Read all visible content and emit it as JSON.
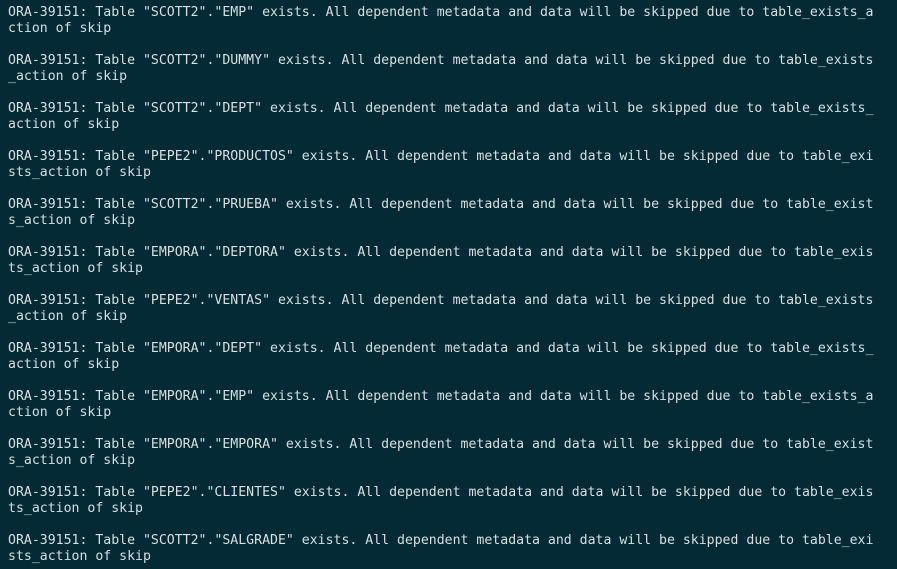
{
  "terminal": {
    "entries": [
      {
        "line1": "ORA-39151: Table \"SCOTT2\".\"EMP\" exists. All dependent metadata and data will be skipped due to table_exists_a",
        "line2": "ction of skip"
      },
      {
        "line1": "ORA-39151: Table \"SCOTT2\".\"DUMMY\" exists. All dependent metadata and data will be skipped due to table_exists",
        "line2": "_action of skip"
      },
      {
        "line1": "ORA-39151: Table \"SCOTT2\".\"DEPT\" exists. All dependent metadata and data will be skipped due to table_exists_",
        "line2": "action of skip"
      },
      {
        "line1": "ORA-39151: Table \"PEPE2\".\"PRODUCTOS\" exists. All dependent metadata and data will be skipped due to table_exi",
        "line2": "sts_action of skip"
      },
      {
        "line1": "ORA-39151: Table \"SCOTT2\".\"PRUEBA\" exists. All dependent metadata and data will be skipped due to table_exist",
        "line2": "s_action of skip"
      },
      {
        "line1": "ORA-39151: Table \"EMPORA\".\"DEPTORA\" exists. All dependent metadata and data will be skipped due to table_exis",
        "line2": "ts_action of skip"
      },
      {
        "line1": "ORA-39151: Table \"PEPE2\".\"VENTAS\" exists. All dependent metadata and data will be skipped due to table_exists",
        "line2": "_action of skip"
      },
      {
        "line1": "ORA-39151: Table \"EMPORA\".\"DEPT\" exists. All dependent metadata and data will be skipped due to table_exists_",
        "line2": "action of skip"
      },
      {
        "line1": "ORA-39151: Table \"EMPORA\".\"EMP\" exists. All dependent metadata and data will be skipped due to table_exists_a",
        "line2": "ction of skip"
      },
      {
        "line1": "ORA-39151: Table \"EMPORA\".\"EMPORA\" exists. All dependent metadata and data will be skipped due to table_exist",
        "line2": "s_action of skip"
      },
      {
        "line1": "ORA-39151: Table \"PEPE2\".\"CLIENTES\" exists. All dependent metadata and data will be skipped due to table_exis",
        "line2": "ts_action of skip"
      },
      {
        "line1": "ORA-39151: Table \"SCOTT2\".\"SALGRADE\" exists. All dependent metadata and data will be skipped due to table_exi",
        "line2": "sts_action of skip"
      }
    ]
  }
}
